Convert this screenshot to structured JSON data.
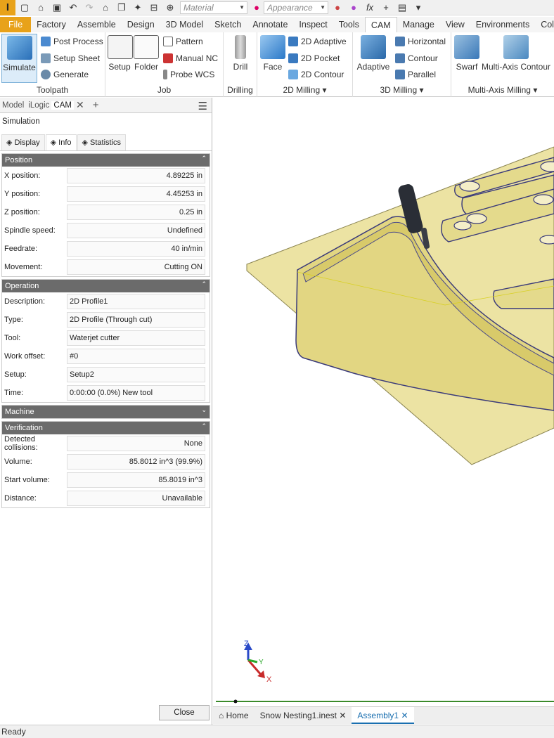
{
  "qat": {
    "material_placeholder": "Material",
    "appearance_placeholder": "Appearance",
    "fx_label": "fx"
  },
  "tabs": [
    "File",
    "Factory",
    "Assemble",
    "Design",
    "3D Model",
    "Sketch",
    "Annotate",
    "Inspect",
    "Tools",
    "CAM",
    "Manage",
    "View",
    "Environments",
    "Col"
  ],
  "ribbon": {
    "toolpath": {
      "simulate": "Simulate",
      "post_process": "Post Process",
      "setup_sheet": "Setup Sheet",
      "generate": "Generate",
      "label": "Toolpath"
    },
    "job": {
      "setup": "Setup",
      "folder": "Folder",
      "pattern": "Pattern",
      "manual_nc": "Manual NC",
      "probe_wcs": "Probe WCS",
      "label": "Job"
    },
    "drilling": {
      "drill": "Drill",
      "label": "Drilling"
    },
    "milling2d": {
      "face": "Face",
      "adaptive": "2D Adaptive",
      "pocket": "2D Pocket",
      "contour": "2D Contour",
      "label": "2D Milling"
    },
    "milling3d": {
      "adaptive": "Adaptive",
      "horizontal": "Horizontal",
      "contour": "Contour",
      "parallel": "Parallel",
      "label": "3D Milling"
    },
    "multiaxis": {
      "swarf": "Swarf",
      "contour": "Multi-Axis Contour",
      "label": "Multi-Axis Milling"
    }
  },
  "panel": {
    "tabs": [
      "Model",
      "iLogic",
      "CAM"
    ],
    "title": "Simulation",
    "subtabs": [
      "Display",
      "Info",
      "Statistics"
    ],
    "position": {
      "header": "Position",
      "rows": [
        {
          "label": "X position:",
          "value": "4.89225 in"
        },
        {
          "label": "Y position:",
          "value": "4.45253 in"
        },
        {
          "label": "Z position:",
          "value": "0.25 in"
        },
        {
          "label": "Spindle speed:",
          "value": "Undefined"
        },
        {
          "label": "Feedrate:",
          "value": "40 in/min"
        },
        {
          "label": "Movement:",
          "value": "Cutting ON"
        }
      ]
    },
    "operation": {
      "header": "Operation",
      "rows": [
        {
          "label": "Description:",
          "value": "2D Profile1"
        },
        {
          "label": "Type:",
          "value": "2D Profile (Through cut)"
        },
        {
          "label": "Tool:",
          "value": "Waterjet cutter"
        },
        {
          "label": "Work offset:",
          "value": "#0"
        },
        {
          "label": "Setup:",
          "value": "Setup2"
        },
        {
          "label": "Time:",
          "value": "0:00:00 (0.0%) New tool"
        }
      ]
    },
    "machine": {
      "header": "Machine"
    },
    "verification": {
      "header": "Verification",
      "rows": [
        {
          "label": "Detected collisions:",
          "value": "None"
        },
        {
          "label": "Volume:",
          "value": "85.8012 in^3 (99.9%)"
        },
        {
          "label": "Start volume:",
          "value": "85.8019 in^3"
        },
        {
          "label": "Distance:",
          "value": "Unavailable"
        }
      ]
    },
    "close": "Close"
  },
  "triad": {
    "x": "X",
    "y": "Y",
    "z": "Z"
  },
  "doctabs": [
    "Home",
    "Snow Nesting1.inest",
    "Assembly1"
  ],
  "status": "Ready",
  "colors": {
    "accent": "#e8a21a",
    "part_fill": "#e6dc8e",
    "part_edge": "#4a4a8a",
    "link": "#1a6fb0"
  }
}
